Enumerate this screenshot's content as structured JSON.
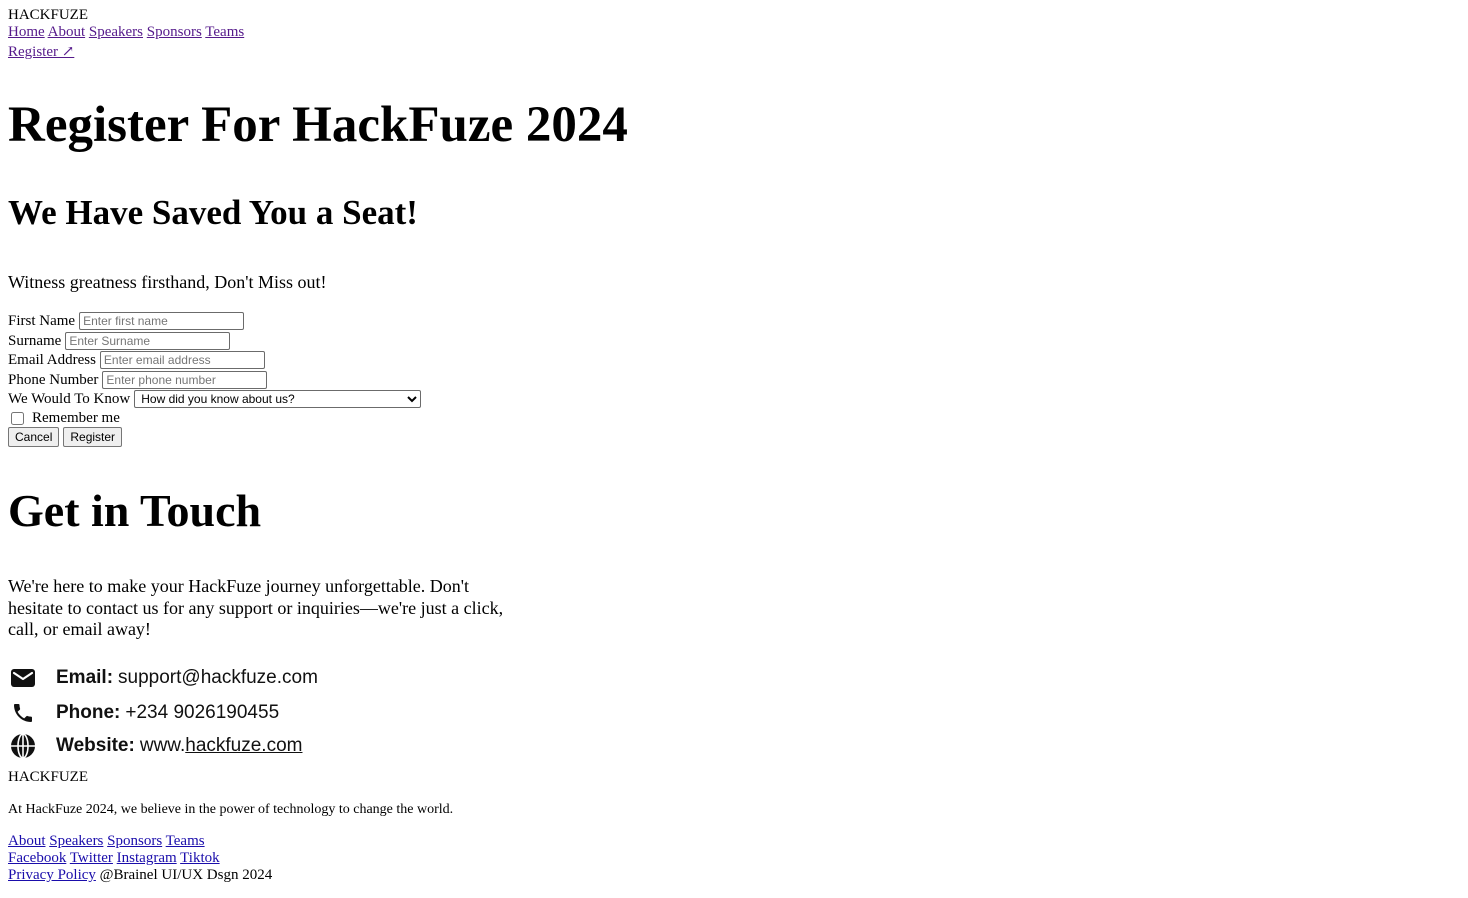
{
  "header": {
    "brand": "HACKFUZE",
    "nav": [
      "Home",
      "About",
      "Speakers",
      "Sponsors",
      "Teams"
    ],
    "register_link": "Register ↗"
  },
  "hero": {
    "title": "Register For HackFuze 2024",
    "subtitle": "We Have Saved You a Seat!",
    "lead": "Witness greatness firsthand, Don't Miss out!"
  },
  "form": {
    "first_name_label": "First Name",
    "first_name_placeholder": "Enter first name",
    "surname_label": "Surname",
    "surname_placeholder": "Enter Surname",
    "email_label": "Email Address",
    "email_placeholder": "Enter email address",
    "phone_label": "Phone Number",
    "phone_placeholder": "Enter phone number",
    "know_label": "We Would To Know",
    "know_selected": "How did you know about us?",
    "remember_label": "Remember me",
    "cancel_label": "Cancel",
    "register_label": "Register"
  },
  "contact": {
    "title": "Get in Touch",
    "body": "We're here to make your HackFuze journey unforgettable. Don't hesitate to contact us for any support or inquiries—we're just a click, call, or email away!",
    "email_label": "Email:",
    "email_value": "support@hackfuze.com",
    "phone_label": "Phone:",
    "phone_value": "+234 9026190455",
    "website_label": "Website:",
    "website_prefix": "www.",
    "website_domain": "hackfuze.com",
    "icons": [
      "envelope-icon",
      "phone-icon",
      "globe-icon"
    ]
  },
  "footer": {
    "brand": "HACKFUZE",
    "tagline": "At HackFuze 2024, we believe in the power of technology to change the world.",
    "links": [
      "About",
      "Speakers",
      "Sponsors",
      "Teams"
    ],
    "socials": [
      "Facebook",
      "Twitter",
      "Instagram",
      "Tiktok"
    ],
    "privacy": "Privacy Policy",
    "credit": "@Brainel UI/UX Dsgn 2024"
  }
}
